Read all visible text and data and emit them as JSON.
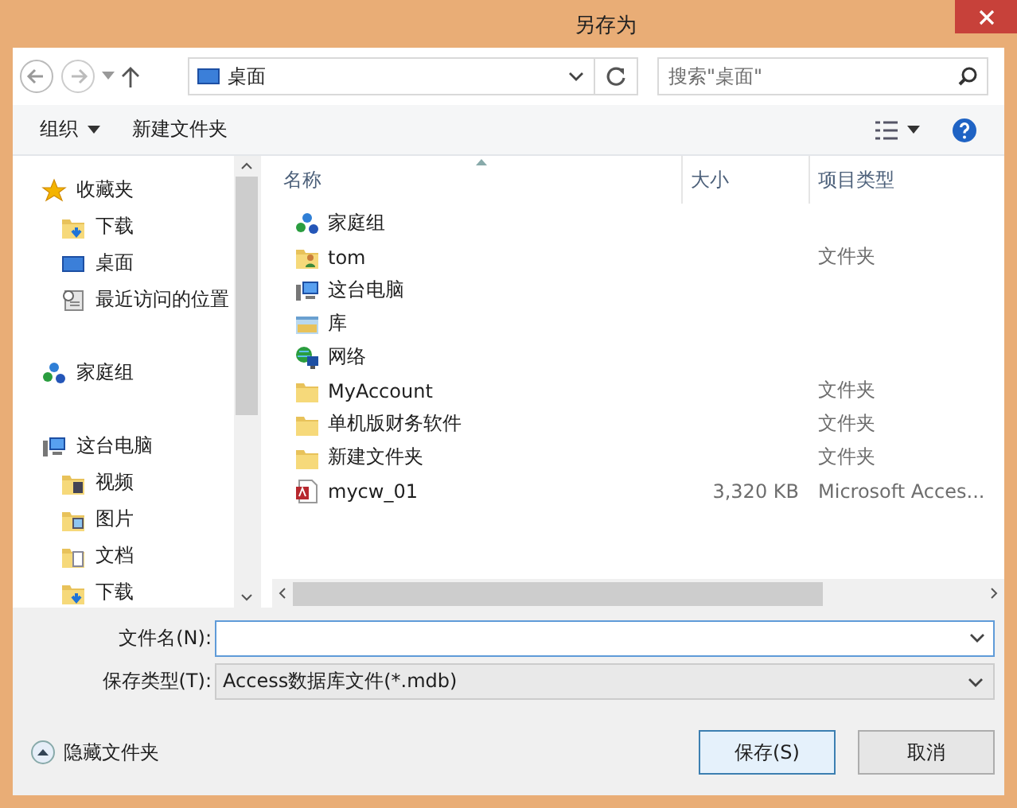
{
  "window": {
    "title": "另存为"
  },
  "address": {
    "location": "桌面"
  },
  "search": {
    "placeholder": "搜索\"桌面\""
  },
  "toolbar": {
    "organize": "组织",
    "new_folder": "新建文件夹"
  },
  "sidebar": {
    "groups": [
      {
        "label": "收藏夹",
        "kind": "star",
        "children": [
          {
            "label": "下载",
            "kind": "download"
          },
          {
            "label": "桌面",
            "kind": "desktop"
          },
          {
            "label": "最近访问的位置",
            "kind": "recent"
          }
        ]
      },
      {
        "label": "家庭组",
        "kind": "homegroup"
      },
      {
        "label": "这台电脑",
        "kind": "computer",
        "children": [
          {
            "label": "视频",
            "kind": "video"
          },
          {
            "label": "图片",
            "kind": "pictures"
          },
          {
            "label": "文档",
            "kind": "documents"
          },
          {
            "label": "下载",
            "kind": "download"
          }
        ]
      }
    ]
  },
  "table": {
    "columns": [
      "名称",
      "大小",
      "项目类型"
    ],
    "rows": [
      {
        "name": "家庭组",
        "kind": "homegroup"
      },
      {
        "name": "tom",
        "kind": "user",
        "type": "文件夹"
      },
      {
        "name": "这台电脑",
        "kind": "computer"
      },
      {
        "name": "库",
        "kind": "library"
      },
      {
        "name": "网络",
        "kind": "network"
      },
      {
        "name": "MyAccount",
        "kind": "folder",
        "type": "文件夹"
      },
      {
        "name": "单机版财务软件",
        "kind": "folder",
        "type": "文件夹"
      },
      {
        "name": "新建文件夹",
        "kind": "folder",
        "type": "文件夹"
      },
      {
        "name": "mycw_01",
        "kind": "access",
        "size": "3,320 KB",
        "type": "Microsoft Acces..."
      }
    ]
  },
  "form": {
    "filename_label": "文件名(N):",
    "filetype_label": "保存类型(T):",
    "filetype": "Access数据库文件(*.mdb)"
  },
  "hide_folders": "隐藏文件夹",
  "buttons": [
    {
      "label": "保存(S)",
      "selected": true
    },
    {
      "label": "取消",
      "selected": false
    }
  ]
}
